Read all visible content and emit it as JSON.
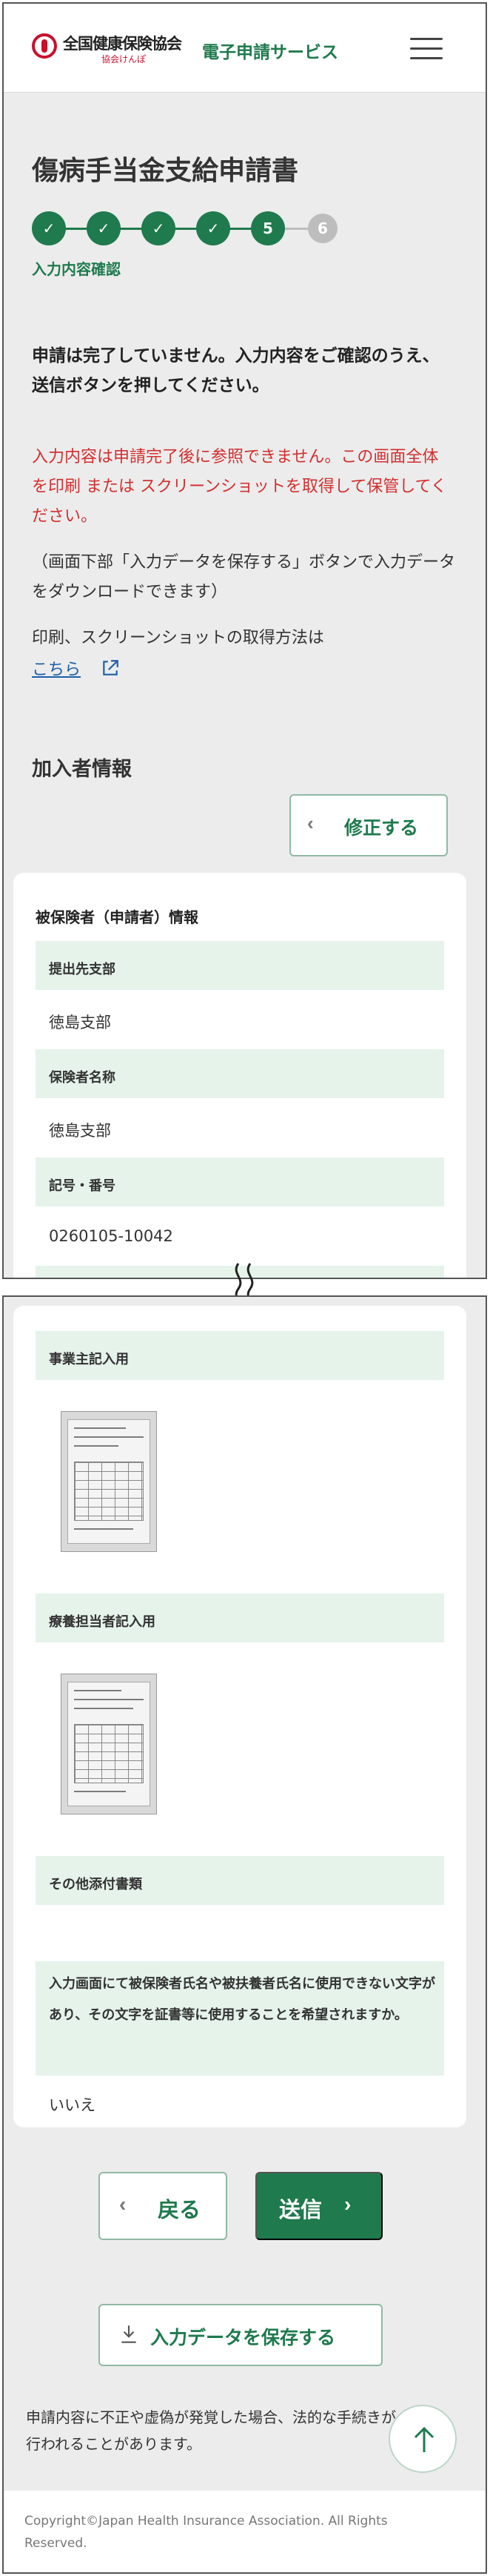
{
  "header": {
    "org_name": "全国健康保険協会",
    "org_sub": "協会けんぽ",
    "service_name": "電子申請サービス"
  },
  "page": {
    "title": "傷病手当金支給申請書"
  },
  "steps": {
    "items": [
      "",
      "",
      "",
      "",
      "5",
      "6"
    ],
    "current": 5,
    "caption": "入力内容確認"
  },
  "notice": {
    "strong": "申請は完了していません。入力内容をご確認のうえ、送信ボタンを押してください。",
    "red": "入力内容は申請完了後に参照できません。この画面全体を印刷 または スクリーンショットを取得して保管してください。",
    "note": "（画面下部「入力データを保存する」ボタンで入力データをダウンロードできます）",
    "howto": "印刷、スクリーンショットの取得方法は",
    "howto_link": "こちら"
  },
  "section": {
    "title": "加入者情報",
    "edit_label": "修正する"
  },
  "insured": {
    "heading": "被保険者（申請者）情報",
    "fields": [
      {
        "label": "提出先支部",
        "value": "徳島支部"
      },
      {
        "label": "保険者名称",
        "value": "徳島支部"
      },
      {
        "label": "記号・番号",
        "value": "0260105-10042"
      }
    ]
  },
  "attachments": {
    "employer_label": "事業主記入用",
    "doctor_label": "療養担当者記入用",
    "other_label": "その他添付書類",
    "question": "入力画面にて被保険者氏名や被扶養者氏名に使用できない文字があり、その文字を証書等に使用することを希望されますか。",
    "answer": "いいえ"
  },
  "actions": {
    "back_label": "戻る",
    "send_label": "送信",
    "save_label": "入力データを保存する"
  },
  "warning": "申請内容に不正や虚偽が発覚した場合、法的な手続きが行われることがあります。",
  "footer": {
    "copyright": "Copyright©Japan Health Insurance Association. All Rights Reserved."
  },
  "colors": {
    "brand_green": "#1f7a4d",
    "alert_red": "#d32f2f",
    "field_bg": "#e5f3ea",
    "link_blue": "#1a5fa8"
  }
}
